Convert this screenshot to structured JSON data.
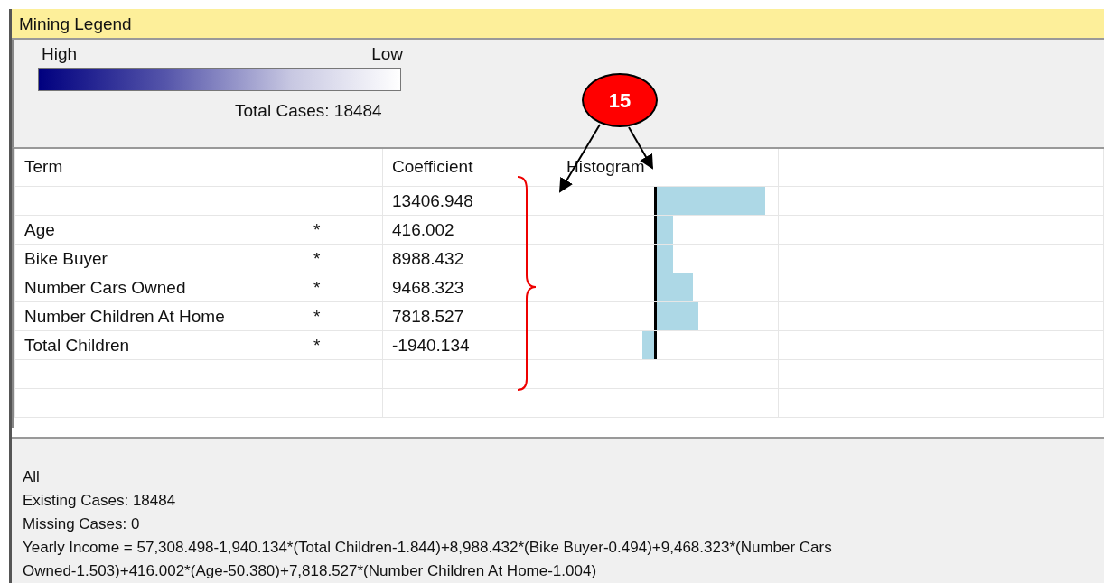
{
  "window": {
    "title": "Mining Legend"
  },
  "legend": {
    "high_label": "High",
    "low_label": "Low",
    "total_cases_label": "Total Cases:",
    "total_cases": "18484"
  },
  "table": {
    "columns": [
      "Term",
      "Coefficient",
      "Histogram"
    ],
    "rows": [
      {
        "term": "",
        "star": "",
        "coefficient": "13406.948"
      },
      {
        "term": "Age",
        "star": "*",
        "coefficient": "416.002"
      },
      {
        "term": "Bike Buyer",
        "star": "*",
        "coefficient": "8988.432"
      },
      {
        "term": "Number Cars Owned",
        "star": "*",
        "coefficient": "9468.323"
      },
      {
        "term": "Number Children At Home",
        "star": "*",
        "coefficient": "7818.527"
      },
      {
        "term": "Total Children",
        "star": "*",
        "coefficient": "-1940.134"
      }
    ]
  },
  "details": [
    "All",
    "Existing Cases: 18484",
    "Missing Cases: 0",
    "Yearly Income = 57,308.498-1,940.134*(Total Children-1.844)+8,988.432*(Bike Buyer-0.494)+9,468.323*(Number Cars Owned-1.503)+416.002*(Age-50.380)+7,818.527*(Number Children At Home-1.004)"
  ],
  "annotation": {
    "label": "15"
  }
}
